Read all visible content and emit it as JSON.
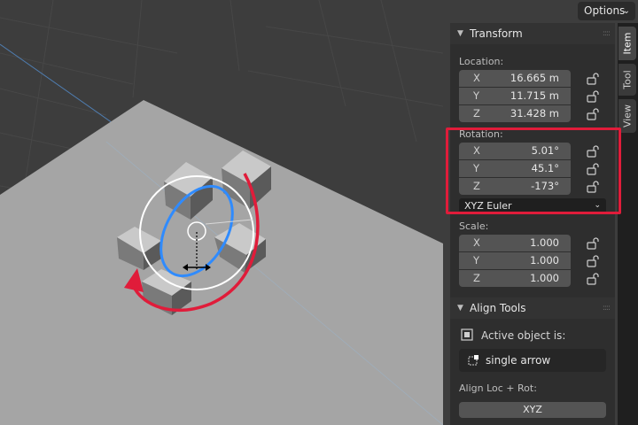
{
  "header": {
    "options_label": "Options"
  },
  "tabs": [
    {
      "label": "Item",
      "active": true
    },
    {
      "label": "Tool",
      "active": false
    },
    {
      "label": "View",
      "active": false
    }
  ],
  "transform": {
    "title": "Transform",
    "location_label": "Location:",
    "location": [
      {
        "axis": "X",
        "value": "16.665 m"
      },
      {
        "axis": "Y",
        "value": "11.715 m"
      },
      {
        "axis": "Z",
        "value": "31.428 m"
      }
    ],
    "rotation_label": "Rotation:",
    "rotation": [
      {
        "axis": "X",
        "value": "5.01°"
      },
      {
        "axis": "Y",
        "value": "45.1°"
      },
      {
        "axis": "Z",
        "value": "-173°"
      }
    ],
    "rotation_mode": "XYZ Euler",
    "scale_label": "Scale:",
    "scale": [
      {
        "axis": "X",
        "value": "1.000"
      },
      {
        "axis": "Y",
        "value": "1.000"
      },
      {
        "axis": "Z",
        "value": "1.000"
      }
    ]
  },
  "align_tools": {
    "title": "Align Tools",
    "active_object_label": "Active object is:",
    "active_object_name": "single arrow",
    "align_loc_rot_label": "Align Loc + Rot:",
    "xyz_button": "XYZ"
  },
  "colors": {
    "highlight": "#e01c3a",
    "rotate_arrow": "#e01c3a",
    "gizmo_blue": "#2f8bff",
    "panel_bg": "#2e2e2e",
    "field_bg": "#545454"
  }
}
